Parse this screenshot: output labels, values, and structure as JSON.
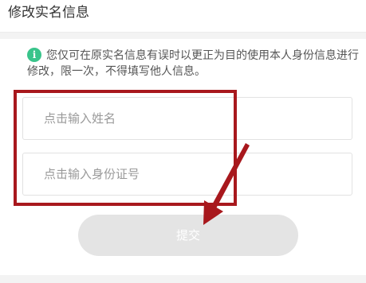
{
  "header": {
    "title": "修改实名信息"
  },
  "notice": {
    "icon": "info-icon",
    "icon_glyph": "i",
    "icon_color": "#39c48b",
    "text": "您仅可在原实名信息有误时以更正为目的使用本人身份信息进行修改，限一次，不得填写他人信息。"
  },
  "form": {
    "name_placeholder": "点击输入姓名",
    "id_placeholder": "点击输入身份证号",
    "submit_label": "提交"
  },
  "annotation": {
    "highlight_color": "#a8181d"
  }
}
